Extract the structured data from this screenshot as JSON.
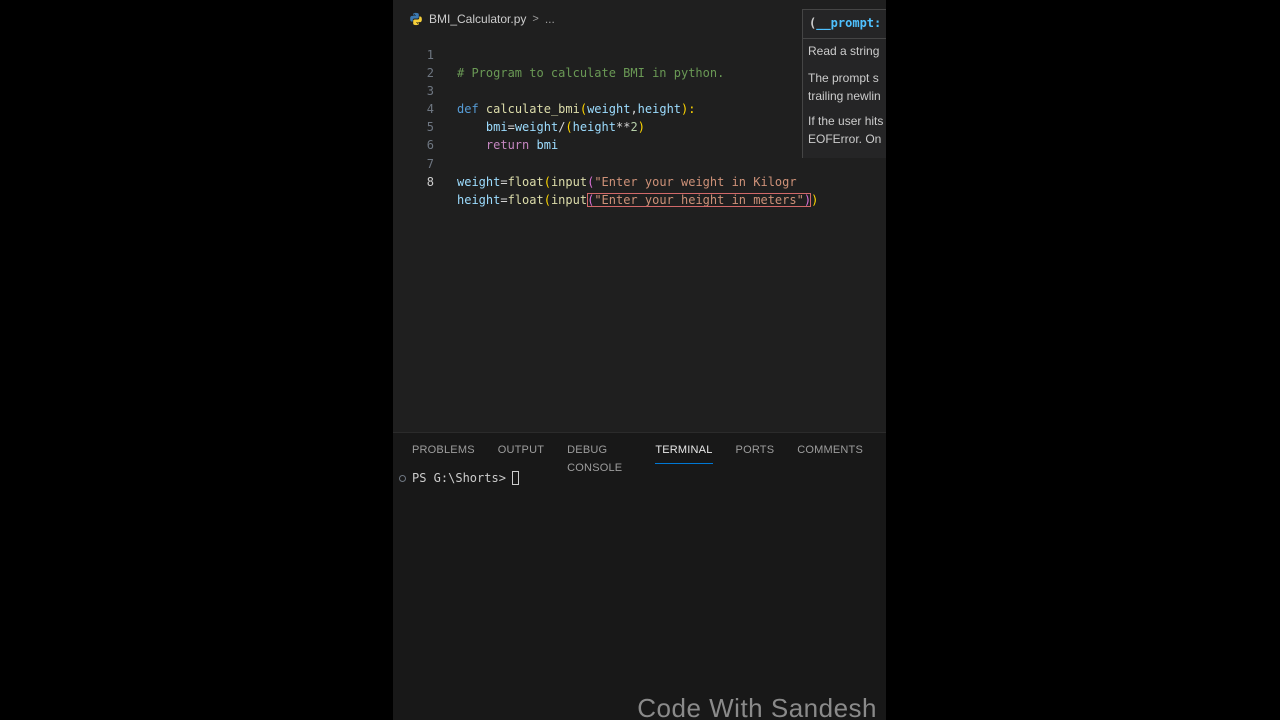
{
  "breadcrumb": {
    "file": "BMI_Calculator.py",
    "separator": ">",
    "more": "..."
  },
  "code": {
    "line_numbers": [
      "1",
      "2",
      "3",
      "4",
      "5",
      "6",
      "7",
      "8"
    ],
    "l1_comment": "# Program to calculate BMI in python.",
    "l3_def": "def",
    "l3_fn": "calculate_bmi",
    "l3_open": "(",
    "l3_p1": "weight",
    "l3_comma": ",",
    "l3_p2": "height",
    "l3_close": "):",
    "l4_var": "bmi",
    "l4_eq": "=",
    "l4_w": "weight",
    "l4_div": "/",
    "l4_open": "(",
    "l4_h": "height",
    "l4_pow": "**",
    "l4_num": "2",
    "l4_close": ")",
    "l5_kw": "return",
    "l5_var": "bmi",
    "l7_var": "weight",
    "l7_eq": "=",
    "l7_float": "float",
    "l7_open1": "(",
    "l7_input": "input",
    "l7_open2": "(",
    "l7_str": "\"Enter your weight in Kilogr",
    "l8_var": "height",
    "l8_eq": "=",
    "l8_float": "float",
    "l8_open1": "(",
    "l8_input": "input",
    "l8_open2": "(",
    "l8_str": "\"Enter your height in meters\"",
    "l8_close2": ")",
    "l8_close1": ")"
  },
  "hover": {
    "signature_open": "(",
    "signature": "__prompt:",
    "para1": "Read a string",
    "para2_l1": "The prompt s",
    "para2_l2": "trailing newlin",
    "para3_l1": "If the user hits",
    "para3_l2": "EOFError. On"
  },
  "panel": {
    "tabs": [
      "PROBLEMS",
      "OUTPUT",
      "DEBUG CONSOLE",
      "TERMINAL",
      "PORTS",
      "COMMENTS"
    ],
    "active_tab": "TERMINAL"
  },
  "terminal": {
    "prompt": "PS G:\\Shorts>"
  },
  "watermark": "Code With Sandesh",
  "colors": {
    "accent": "#0078d4",
    "editor_bg": "#1f1f1f",
    "hover_sig": "#4fc1ff"
  }
}
